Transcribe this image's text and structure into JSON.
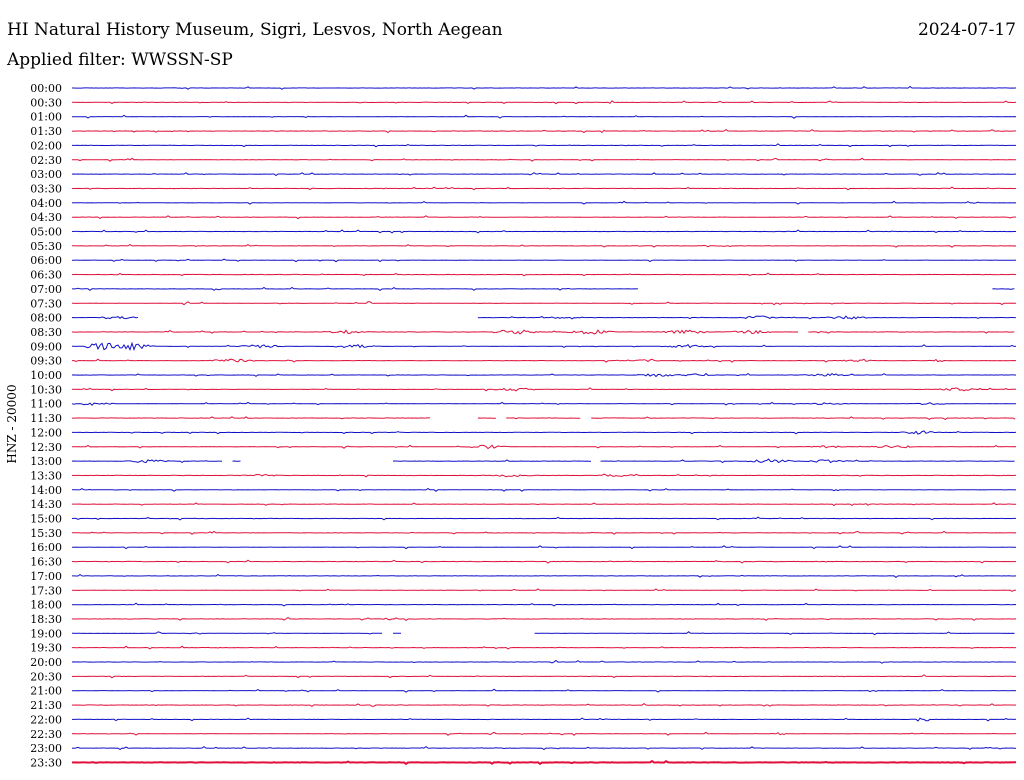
{
  "header": {
    "title": "HI Natural History Museum, Sigri, Lesvos, North Aegean",
    "date": "2024-07-17",
    "filter": "Applied filter: WWSSN-SP"
  },
  "chart_data": {
    "type": "line",
    "ylabel": "HNZ - 20000",
    "colors": {
      "even": "#1010c8",
      "odd": "#e0103c",
      "background": "#ffffff"
    },
    "rows": [
      "00:00",
      "00:30",
      "01:00",
      "01:30",
      "02:00",
      "02:30",
      "03:00",
      "03:30",
      "04:00",
      "04:30",
      "05:00",
      "05:30",
      "06:00",
      "06:30",
      "07:00",
      "07:30",
      "08:00",
      "08:30",
      "09:00",
      "09:30",
      "10:00",
      "10:30",
      "11:00",
      "11:30",
      "12:00",
      "12:30",
      "13:00",
      "13:30",
      "14:00",
      "14:30",
      "15:00",
      "15:30",
      "16:00",
      "16:30",
      "17:00",
      "17:30",
      "18:00",
      "18:30",
      "19:00",
      "19:30",
      "20:00",
      "20:30",
      "21:00",
      "21:30",
      "22:00",
      "22:30",
      "23:00",
      "23:30"
    ],
    "events": [
      {
        "row": 16,
        "bursts": [
          [
            0.05,
            0.3
          ],
          [
            0.35,
            0.2
          ],
          [
            0.52,
            0.2
          ],
          [
            0.73,
            0.3
          ],
          [
            0.82,
            0.3
          ]
        ]
      },
      {
        "row": 17,
        "bursts": [
          [
            0.29,
            0.3
          ],
          [
            0.47,
            0.5
          ],
          [
            0.55,
            0.4
          ],
          [
            0.65,
            0.4
          ],
          [
            0.72,
            0.3
          ]
        ]
      },
      {
        "row": 18,
        "bursts": [
          [
            0.04,
            1.0
          ],
          [
            0.06,
            0.8
          ],
          [
            0.2,
            0.3
          ],
          [
            0.3,
            0.3
          ],
          [
            0.65,
            0.3
          ]
        ]
      },
      {
        "row": 19,
        "bursts": [
          [
            0.17,
            0.3
          ],
          [
            0.6,
            0.2
          ],
          [
            0.83,
            0.2
          ]
        ]
      },
      {
        "row": 20,
        "bursts": [
          [
            0.62,
            0.3
          ],
          [
            0.66,
            0.2
          ],
          [
            0.8,
            0.3
          ]
        ]
      },
      {
        "row": 21,
        "bursts": [
          [
            0.47,
            0.3
          ],
          [
            0.94,
            0.3
          ]
        ]
      },
      {
        "row": 22,
        "bursts": [
          [
            0.02,
            0.3
          ],
          [
            0.8,
            0.2
          ],
          [
            0.91,
            0.2
          ]
        ]
      },
      {
        "row": 24,
        "bursts": [
          [
            0.9,
            0.3
          ]
        ]
      },
      {
        "row": 25,
        "bursts": [
          [
            0.44,
            0.3
          ],
          [
            0.8,
            0.2
          ],
          [
            0.87,
            0.3
          ]
        ]
      },
      {
        "row": 26,
        "bursts": [
          [
            0.08,
            0.3
          ],
          [
            0.74,
            0.4
          ],
          [
            0.8,
            0.3
          ]
        ]
      },
      {
        "row": 27,
        "bursts": [
          [
            0.2,
            0.2
          ],
          [
            0.47,
            0.2
          ],
          [
            0.58,
            0.2
          ]
        ]
      }
    ],
    "gaps": [
      {
        "row": 14,
        "segments": [
          [
            0.0,
            0.6
          ],
          [
            0.975,
            1.0
          ]
        ]
      },
      {
        "row": 16,
        "segments": [
          [
            0.0,
            0.07
          ],
          [
            0.43,
            1.0
          ]
        ]
      },
      {
        "row": 17,
        "segments": [
          [
            0.0,
            0.77
          ],
          [
            0.78,
            1.0
          ]
        ]
      },
      {
        "row": 23,
        "segments": [
          [
            0.0,
            0.38
          ],
          [
            0.43,
            0.45
          ],
          [
            0.46,
            0.54
          ],
          [
            0.55,
            1.0
          ]
        ]
      },
      {
        "row": 26,
        "segments": [
          [
            0.0,
            0.16
          ],
          [
            0.17,
            0.18
          ],
          [
            0.34,
            0.55
          ],
          [
            0.56,
            1.0
          ]
        ]
      },
      {
        "row": 38,
        "segments": [
          [
            0.0,
            0.33
          ],
          [
            0.34,
            0.35
          ],
          [
            0.49,
            1.0
          ]
        ]
      }
    ]
  }
}
